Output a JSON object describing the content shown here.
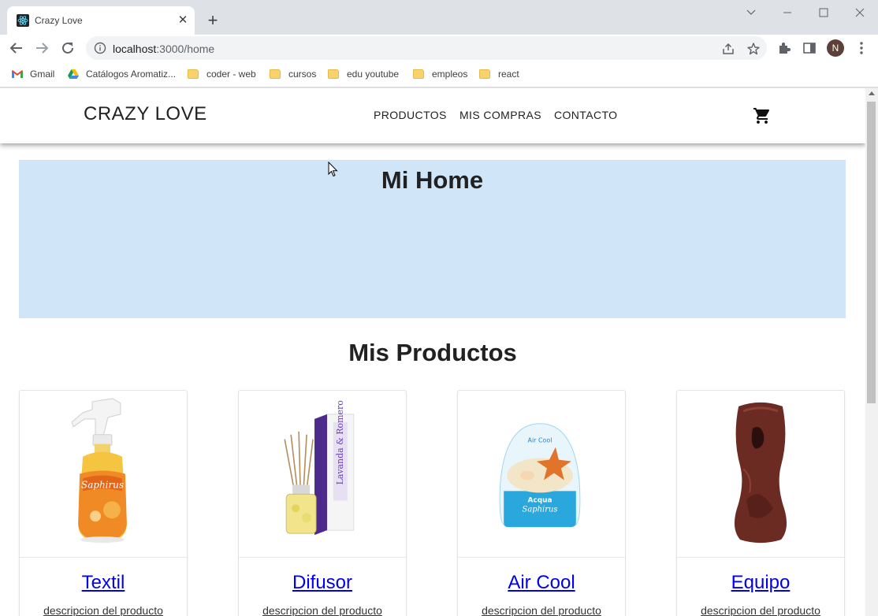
{
  "browser": {
    "tab_title": "Crazy Love",
    "tab_close": "✕",
    "new_tab": "+",
    "url_host": "localhost",
    "url_path": ":3000/home",
    "profile_initial": "N",
    "bookmarks": [
      {
        "label": "Gmail",
        "icon": "gmail-icon"
      },
      {
        "label": "Catálogos Aromatiz...",
        "icon": "drive-icon"
      },
      {
        "label": "coder - web",
        "icon": "folder-icon"
      },
      {
        "label": "cursos",
        "icon": "folder-icon"
      },
      {
        "label": "edu youtube",
        "icon": "folder-icon"
      },
      {
        "label": "empleos",
        "icon": "folder-icon"
      },
      {
        "label": "react",
        "icon": "folder-icon"
      }
    ]
  },
  "app": {
    "brand": "CRAZY LOVE",
    "nav": [
      "PRODUCTOS",
      "MIS COMPRAS",
      "CONTACTO"
    ],
    "cart_icon": "shopping-cart-icon",
    "hero_title": "Mi Home",
    "section_title": "Mis Productos",
    "hero_color": "#d0e5f8",
    "link_color": "#0000ee",
    "products": [
      {
        "title": "Textil",
        "description": "descripcion del producto",
        "image": "spray-bottle-image"
      },
      {
        "title": "Difusor",
        "description": "descripcion del producto",
        "image": "reed-diffuser-image"
      },
      {
        "title": "Air Cool",
        "description": "descripcion del producto",
        "image": "gel-air-freshener-image"
      },
      {
        "title": "Equipo",
        "description": "descripcion del producto",
        "image": "dispenser-device-image"
      }
    ]
  }
}
